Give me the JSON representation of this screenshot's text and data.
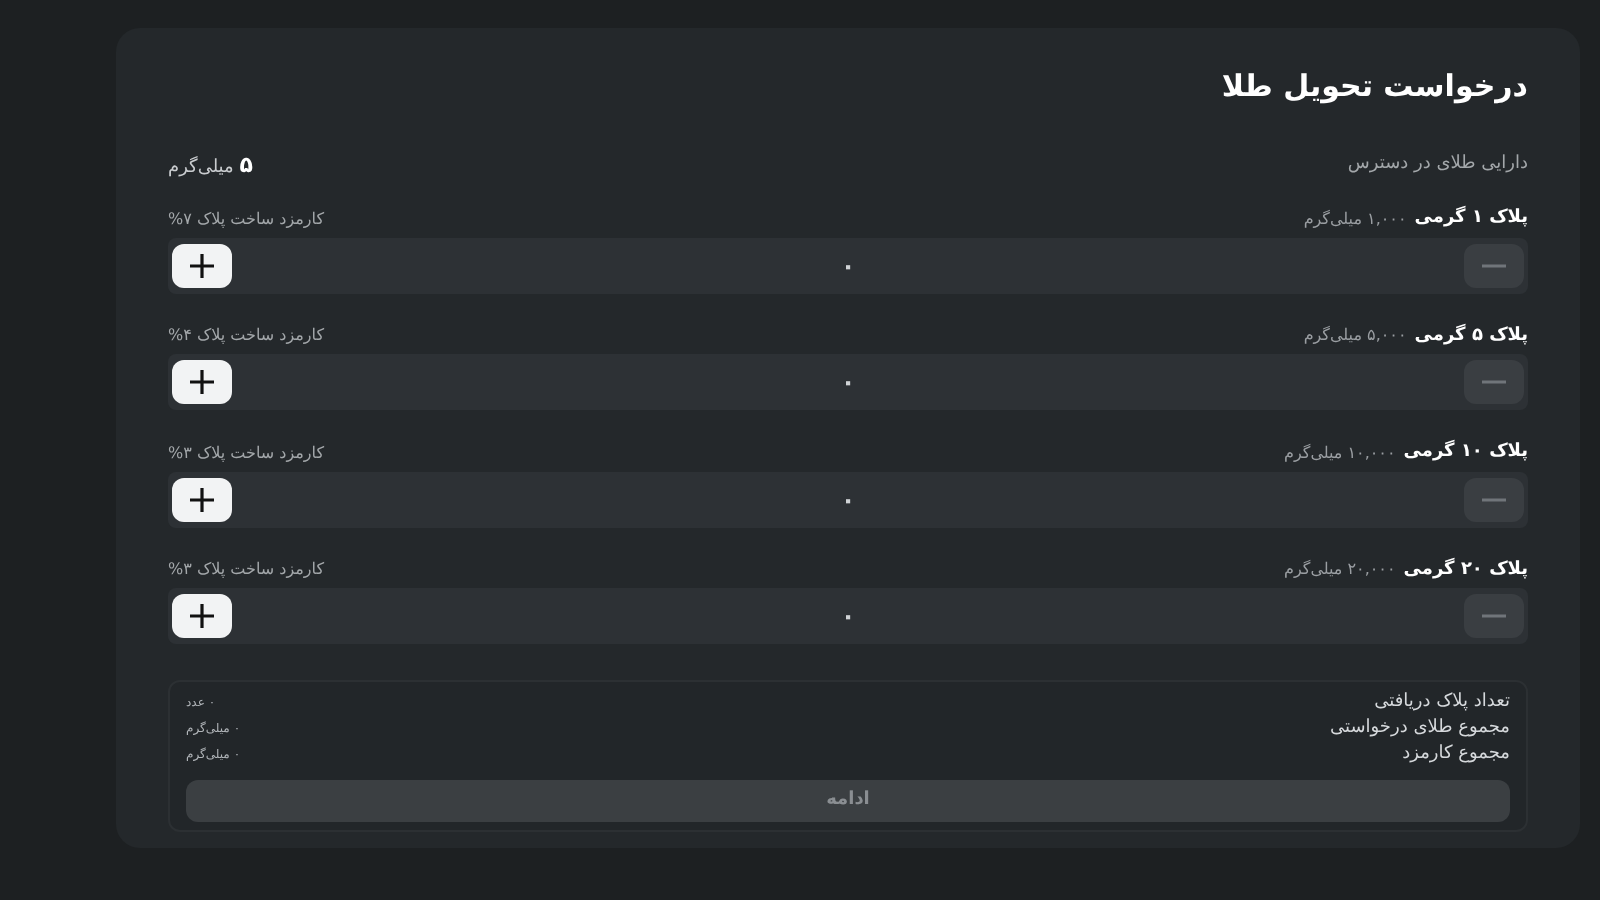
{
  "title": "درخواست تحویل طلا",
  "balance": {
    "label": "دارایی طلای در دسترس",
    "value": "۵",
    "unit": "میلی‌گرم"
  },
  "plates": [
    {
      "name": "پلاک ۱ گرمی",
      "weight": "۱,۰۰۰ میلی‌گرم",
      "fee": "کارمزد ساخت پلاک ۷%",
      "count": "۰",
      "decrement_disabled": true,
      "increment_disabled": false
    },
    {
      "name": "پلاک ۵ گرمی",
      "weight": "۵,۰۰۰ میلی‌گرم",
      "fee": "کارمزد ساخت پلاک ۴%",
      "count": "۰",
      "decrement_disabled": true,
      "increment_disabled": false
    },
    {
      "name": "پلاک ۱۰ گرمی",
      "weight": "۱۰,۰۰۰ میلی‌گرم",
      "fee": "کارمزد ساخت پلاک ۳%",
      "count": "۰",
      "decrement_disabled": true,
      "increment_disabled": false
    },
    {
      "name": "پلاک ۲۰ گرمی",
      "weight": "۲۰,۰۰۰ میلی‌گرم",
      "fee": "کارمزد ساخت پلاک ۳%",
      "count": "۰",
      "decrement_disabled": true,
      "increment_disabled": false
    }
  ],
  "summary": [
    {
      "label": "تعداد پلاک دریافتی",
      "value": "۰",
      "unit": "عدد"
    },
    {
      "label": "مجموع طلای درخواستی",
      "value": "۰",
      "unit": "میلی‌گرم"
    },
    {
      "label": "مجموع کارمزد",
      "value": "۰",
      "unit": "میلی‌گرم"
    }
  ],
  "continue_button": {
    "label": "ادامه",
    "disabled": true
  }
}
